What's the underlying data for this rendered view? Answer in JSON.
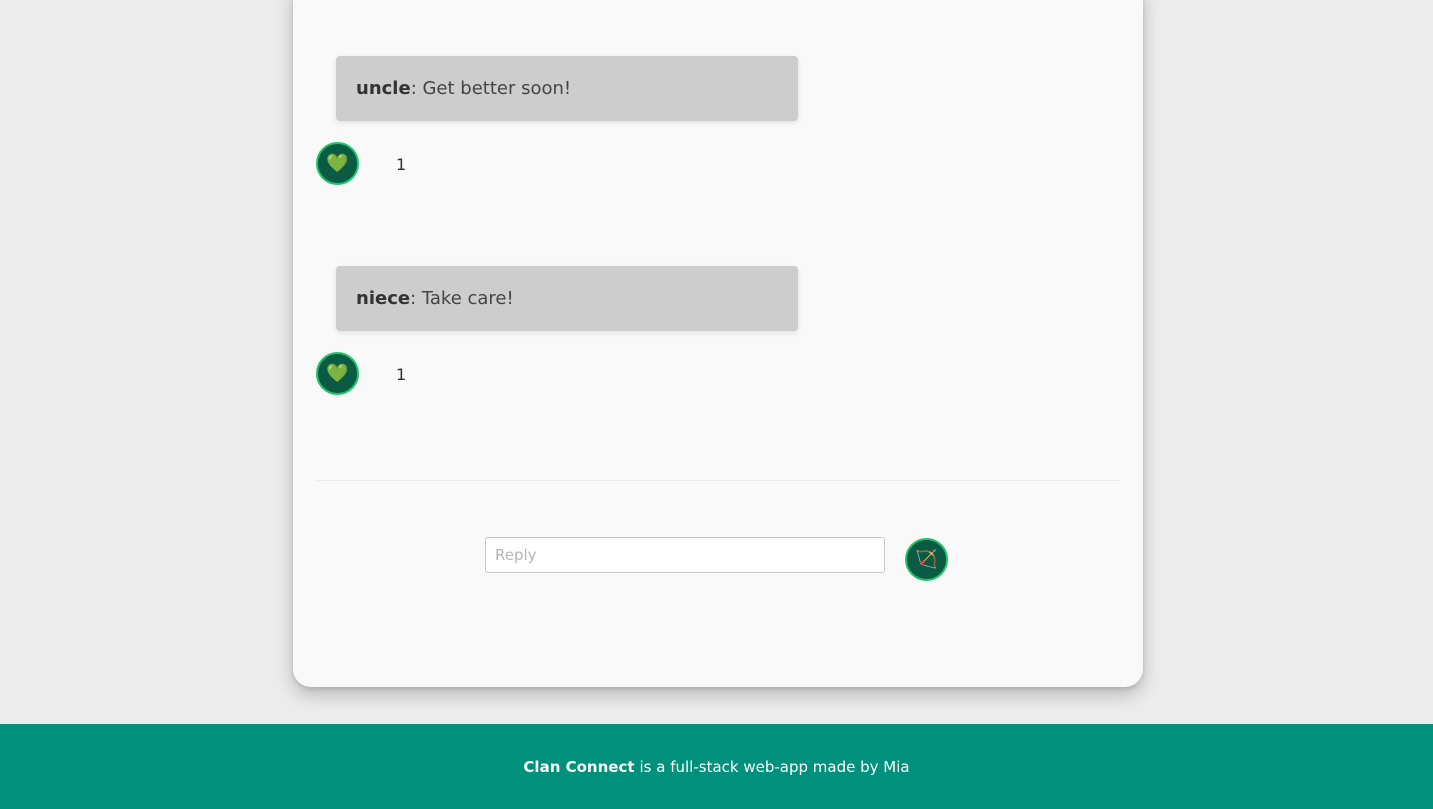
{
  "comments": [
    {
      "author": "uncle",
      "text": ": Get better soon!",
      "likes": "1",
      "heart_icon": "💚"
    },
    {
      "author": "niece",
      "text": ": Take care!",
      "likes": "1",
      "heart_icon": "💚"
    }
  ],
  "reply": {
    "placeholder": "Reply",
    "value": "",
    "send_icon": "🏹"
  },
  "footer": {
    "brand": "Clan Connect",
    "text": "is a full-stack web-app made by Mia"
  },
  "colors": {
    "page_background": "#ececec",
    "card_background": "#f9f9f9",
    "bubble_background": "#cdcdcd",
    "button_fill": "#0a5a44",
    "button_border": "#1fc36a",
    "footer_background": "#00907b"
  }
}
